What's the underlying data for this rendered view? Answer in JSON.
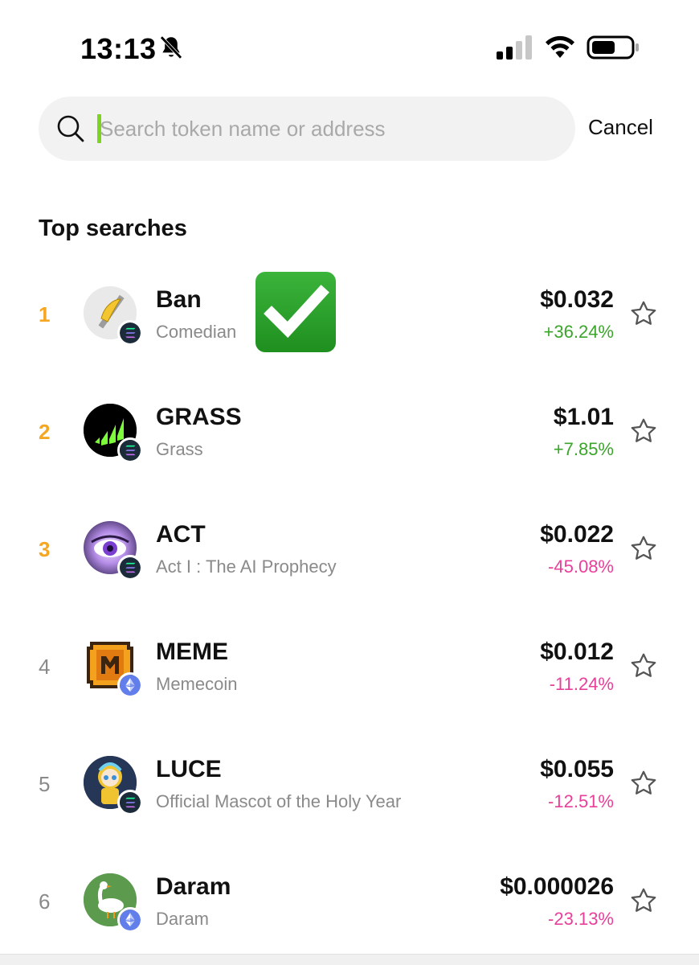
{
  "status_bar": {
    "time": "13:13"
  },
  "search": {
    "placeholder": "Search token name or address",
    "value": "",
    "cancel_label": "Cancel"
  },
  "section": {
    "title": "Top searches"
  },
  "tokens": [
    {
      "rank": "1",
      "symbol": "Ban",
      "name": "Comedian",
      "price": "$0.032",
      "change": "+36.24%",
      "direction": "up",
      "chain": "solana"
    },
    {
      "rank": "2",
      "symbol": "GRASS",
      "name": "Grass",
      "price": "$1.01",
      "change": "+7.85%",
      "direction": "up",
      "chain": "solana"
    },
    {
      "rank": "3",
      "symbol": "ACT",
      "name": "Act I : The AI Prophecy",
      "price": "$0.022",
      "change": "-45.08%",
      "direction": "down",
      "chain": "solana"
    },
    {
      "rank": "4",
      "symbol": "MEME",
      "name": "Memecoin",
      "price": "$0.012",
      "change": "-11.24%",
      "direction": "down",
      "chain": "ethereum"
    },
    {
      "rank": "5",
      "symbol": "LUCE",
      "name": "Official Mascot of the Holy Year",
      "price": "$0.055",
      "change": "-12.51%",
      "direction": "down",
      "chain": "solana"
    },
    {
      "rank": "6",
      "symbol": "Daram",
      "name": "Daram",
      "price": "$0.000026",
      "change": "-23.13%",
      "direction": "down",
      "chain": "ethereum"
    }
  ],
  "colors": {
    "accent_rank": "#f5a623",
    "up": "#3aa52a",
    "down": "#e8409a",
    "caret": "#7ed321"
  }
}
